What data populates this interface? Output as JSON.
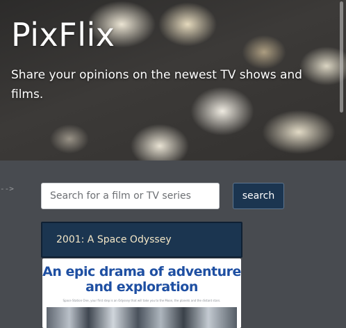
{
  "hero": {
    "title": "PixFlix",
    "tagline": "Share your opinions on the newest TV shows and films."
  },
  "decor": {
    "arrow_text": "-->"
  },
  "search": {
    "placeholder": "Search for a film or TV series",
    "value": "",
    "button_label": "search"
  },
  "results": [
    {
      "title": "2001: A Space Odyssey",
      "poster_headline": "An epic drama of adventure and exploration",
      "poster_fineprint": "Space Station One, your first step is an Odyssey that will take you to the Moon, the planets and the distant stars."
    }
  ],
  "colors": {
    "page_background": "#484b50",
    "accent_navy": "#1b3550",
    "result_title_text": "#f3e6c6",
    "poster_headline": "#1e4fa2"
  }
}
